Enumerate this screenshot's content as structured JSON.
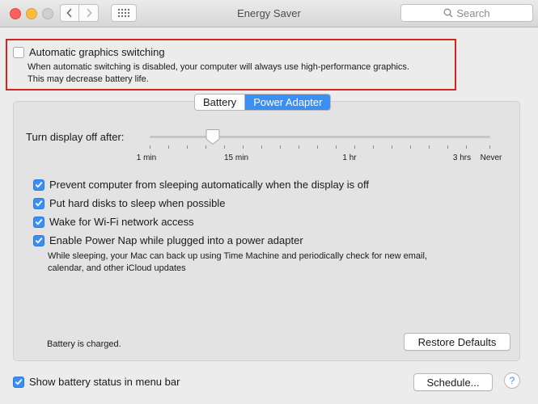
{
  "window": {
    "title": "Energy Saver",
    "search_placeholder": "Search"
  },
  "graphics": {
    "label": "Automatic graphics switching",
    "checked": false,
    "description_line1": "When automatic switching is disabled, your computer will always use high-performance graphics.",
    "description_line2": "This may decrease battery life."
  },
  "tabs": {
    "battery": "Battery",
    "power_adapter": "Power Adapter",
    "selected": "Power Adapter"
  },
  "slider": {
    "label": "Turn display off after:",
    "value": "10 min",
    "ticks": [
      "1 min",
      "15 min",
      "1 hr",
      "3 hrs",
      "Never"
    ]
  },
  "options": [
    {
      "label": "Prevent computer from sleeping automatically when the display is off",
      "checked": true
    },
    {
      "label": "Put hard disks to sleep when possible",
      "checked": true
    },
    {
      "label": "Wake for Wi-Fi network access",
      "checked": true
    },
    {
      "label": "Enable Power Nap while plugged into a power adapter",
      "checked": true
    }
  ],
  "power_nap_desc": {
    "line1": "While sleeping, your Mac can back up using Time Machine and periodically check for new email,",
    "line2": "calendar, and other iCloud updates"
  },
  "status": "Battery is charged.",
  "buttons": {
    "restore": "Restore Defaults",
    "schedule": "Schedule...",
    "help": "?"
  },
  "menu_bar": {
    "label": "Show battery status in menu bar",
    "checked": true
  },
  "colors": {
    "accent": "#3b8ff2",
    "highlight": "#d3271b"
  }
}
